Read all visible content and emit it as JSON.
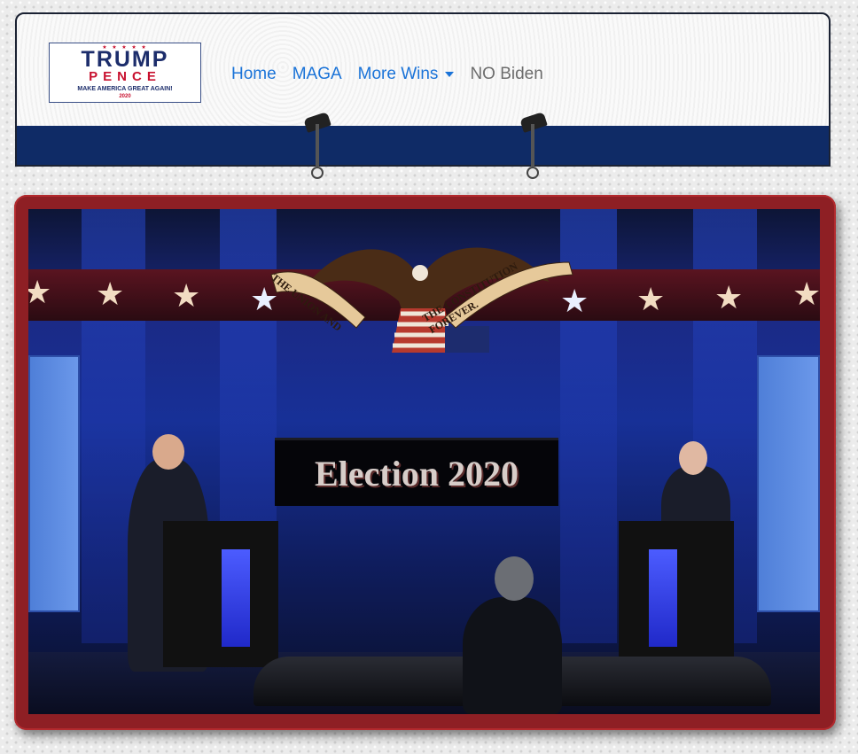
{
  "logo": {
    "stars": "★ ★ ★ ★ ★",
    "line1": "TRUMP",
    "line2": "PENCE",
    "line3": "MAKE AMERICA GREAT AGAIN!",
    "line4": "2020"
  },
  "nav": {
    "items": [
      {
        "label": "Home"
      },
      {
        "label": "MAGA"
      },
      {
        "label": "More Wins"
      },
      {
        "label": "NO Biden"
      }
    ]
  },
  "stage": {
    "banner_left": "THE UNION AND",
    "banner_right": "THE CONSTITUTION FOREVER.",
    "title": "Election 2020"
  },
  "colors": {
    "nav_strip": "#0f2b66",
    "frame": "#8e1f24",
    "link": "#1a73d8"
  }
}
